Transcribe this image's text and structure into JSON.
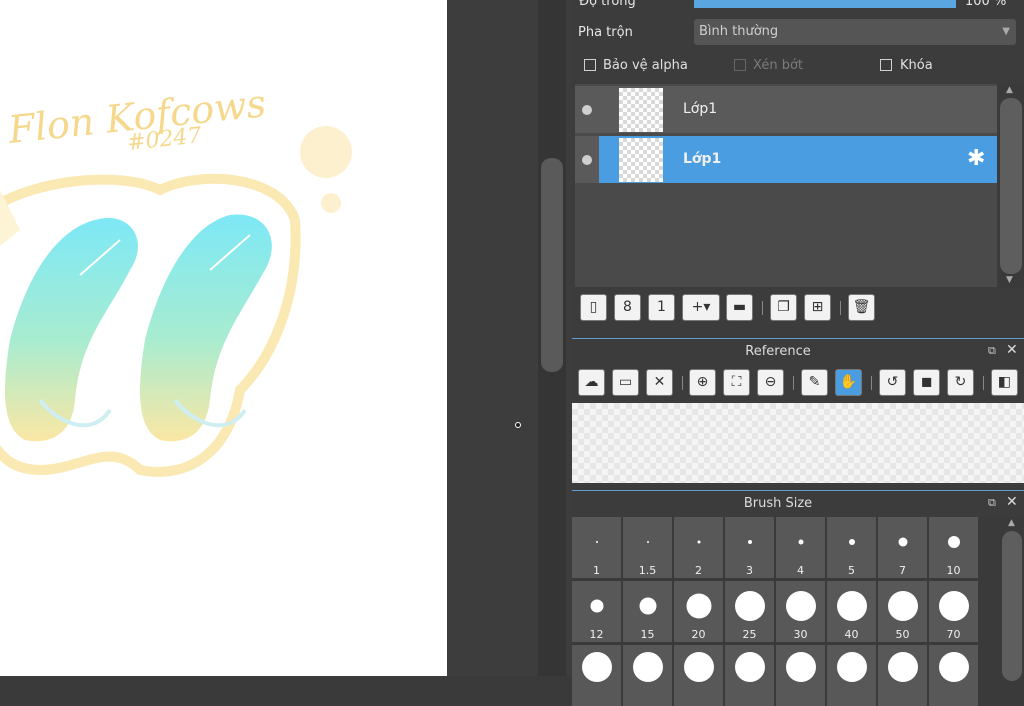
{
  "layer_properties": {
    "opacity_label": "Độ trong",
    "opacity_value": "100 %",
    "blend_label": "Pha trộn",
    "blend_value": "Bình thường",
    "protect_alpha_label": "Bảo vệ alpha",
    "clipping_label": "Xén bớt",
    "lock_label": "Khóa"
  },
  "layers": [
    {
      "name": "Lớp1",
      "selected": false
    },
    {
      "name": "Lớp1",
      "selected": true
    }
  ],
  "layer_toolbar": [
    "new-layer-icon",
    "new-8bit-layer-icon",
    "new-1bit-layer-icon",
    "add-layer-menu-icon",
    "new-folder-icon",
    "duplicate-layer-icon",
    "merge-down-icon",
    "delete-layer-icon"
  ],
  "reference": {
    "title": "Reference",
    "tools": [
      "upload-cloud-icon",
      "open-folder-icon",
      "close-icon",
      "zoom-in-icon",
      "fit-screen-icon",
      "zoom-out-icon",
      "eyedropper-icon",
      "hand-icon",
      "rotate-left-icon",
      "fullscreen-icon",
      "rotate-right-icon",
      "flip-icon"
    ],
    "active_tool": "hand-icon"
  },
  "brush_size": {
    "title": "Brush Size",
    "sizes": [
      "1",
      "1.5",
      "2",
      "3",
      "4",
      "5",
      "7",
      "10",
      "12",
      "15",
      "20",
      "25",
      "30",
      "40",
      "50",
      "70"
    ]
  },
  "canvas": {
    "signature": "Flon Kofcows",
    "number": "#0247"
  },
  "colors": {
    "accent": "#4a9de0",
    "panel_bg": "#3c3c3c",
    "selected_layer": "#4a9de0"
  }
}
